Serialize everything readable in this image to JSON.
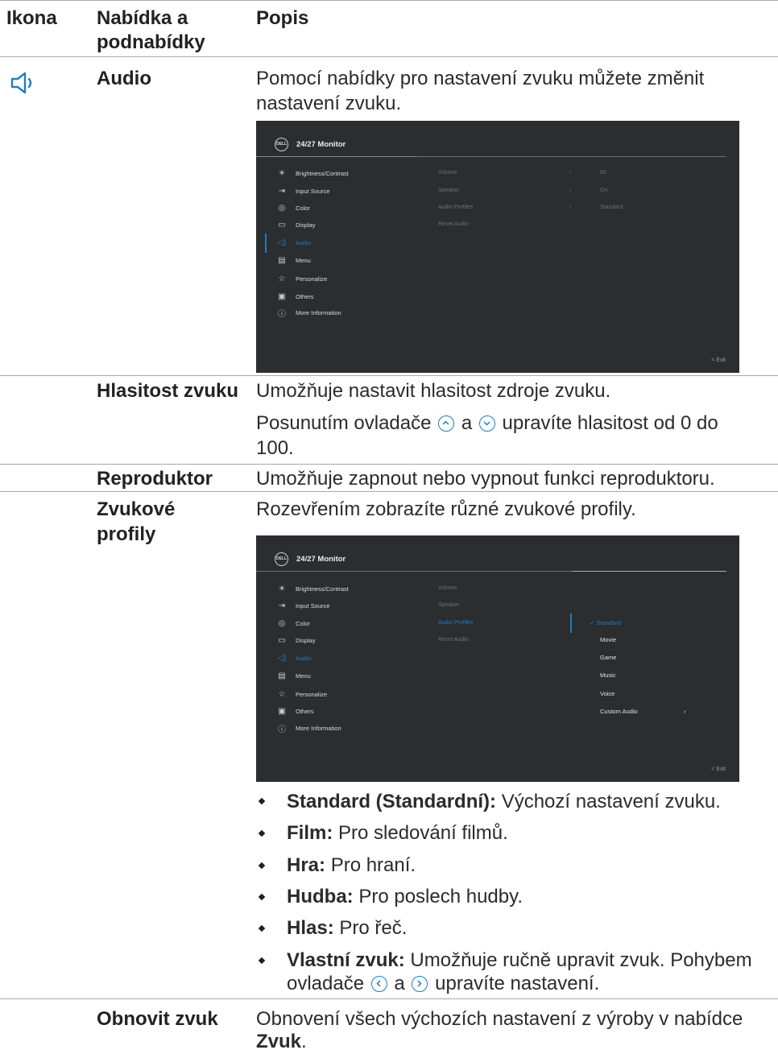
{
  "header": {
    "col_icon": "Ikona",
    "col_menu": "Nabídka a podnabídky",
    "col_desc": "Popis"
  },
  "audio": {
    "icon": "speaker-icon",
    "name": "Audio",
    "desc": "Pomocí nabídky pro nastavení zvuku můžete změnit nastavení zvuku."
  },
  "osd": {
    "title": "24/27 Monitor",
    "logo": "DELL",
    "menu": [
      {
        "label": "Brightness/Contrast",
        "icon": "sun-icon"
      },
      {
        "label": "Input Source",
        "icon": "input-source-icon"
      },
      {
        "label": "Color",
        "icon": "palette-icon"
      },
      {
        "label": "Display",
        "icon": "display-icon"
      },
      {
        "label": "Audio",
        "icon": "speaker-icon"
      },
      {
        "label": "Menu",
        "icon": "menu-icon"
      },
      {
        "label": "Personalize",
        "icon": "star-icon"
      },
      {
        "label": "Others",
        "icon": "others-icon"
      },
      {
        "label": "More Information",
        "icon": "info-icon"
      }
    ],
    "sub": [
      "Volume",
      "Speaker",
      "Audio Profiles",
      "Reset Audio"
    ],
    "values": [
      "50",
      "On",
      "Standard"
    ],
    "chev": "›",
    "exit": "< Exit",
    "profiles": [
      "Standard",
      "Movie",
      "Game",
      "Music",
      "Voice",
      "Custom Audio"
    ],
    "check": "✓"
  },
  "volume": {
    "name": "Hlasitost zvuku",
    "desc1": "Umožňuje nastavit hlasitost zdroje zvuku.",
    "desc2a": "Posunutím ovladače",
    "and": "a",
    "desc2b": "upravíte hlasitost od 0 do 100."
  },
  "speaker": {
    "name": "Reproduktor",
    "desc": "Umožňuje zapnout nebo vypnout funkci reproduktoru."
  },
  "profiles": {
    "name": "Zvukové profily",
    "desc": "Rozevřením zobrazíte různé zvukové profily.",
    "bullets": [
      {
        "term": "Standard (Standardní):",
        "text": "Výchozí nastavení zvuku."
      },
      {
        "term": "Film:",
        "text": "Pro sledování filmů."
      },
      {
        "term": "Hra:",
        "text": "Pro hraní."
      },
      {
        "term": "Hudba:",
        "text": "Pro poslech hudby."
      },
      {
        "term": "Hlas:",
        "text": "Pro řeč."
      },
      {
        "term": "Vlastní zvuk:",
        "text": "Umožňuje ručně upravit zvuk. Pohybem",
        "text2a": "ovladače",
        "and": "a",
        "text2b": "upravíte nastavení."
      }
    ]
  },
  "reset": {
    "name": "Obnovit zvuk",
    "desc": "Obnovení všech výchozích nastavení z výroby v nabídce",
    "desc_bold": "Zvuk",
    "desc_end": "."
  }
}
